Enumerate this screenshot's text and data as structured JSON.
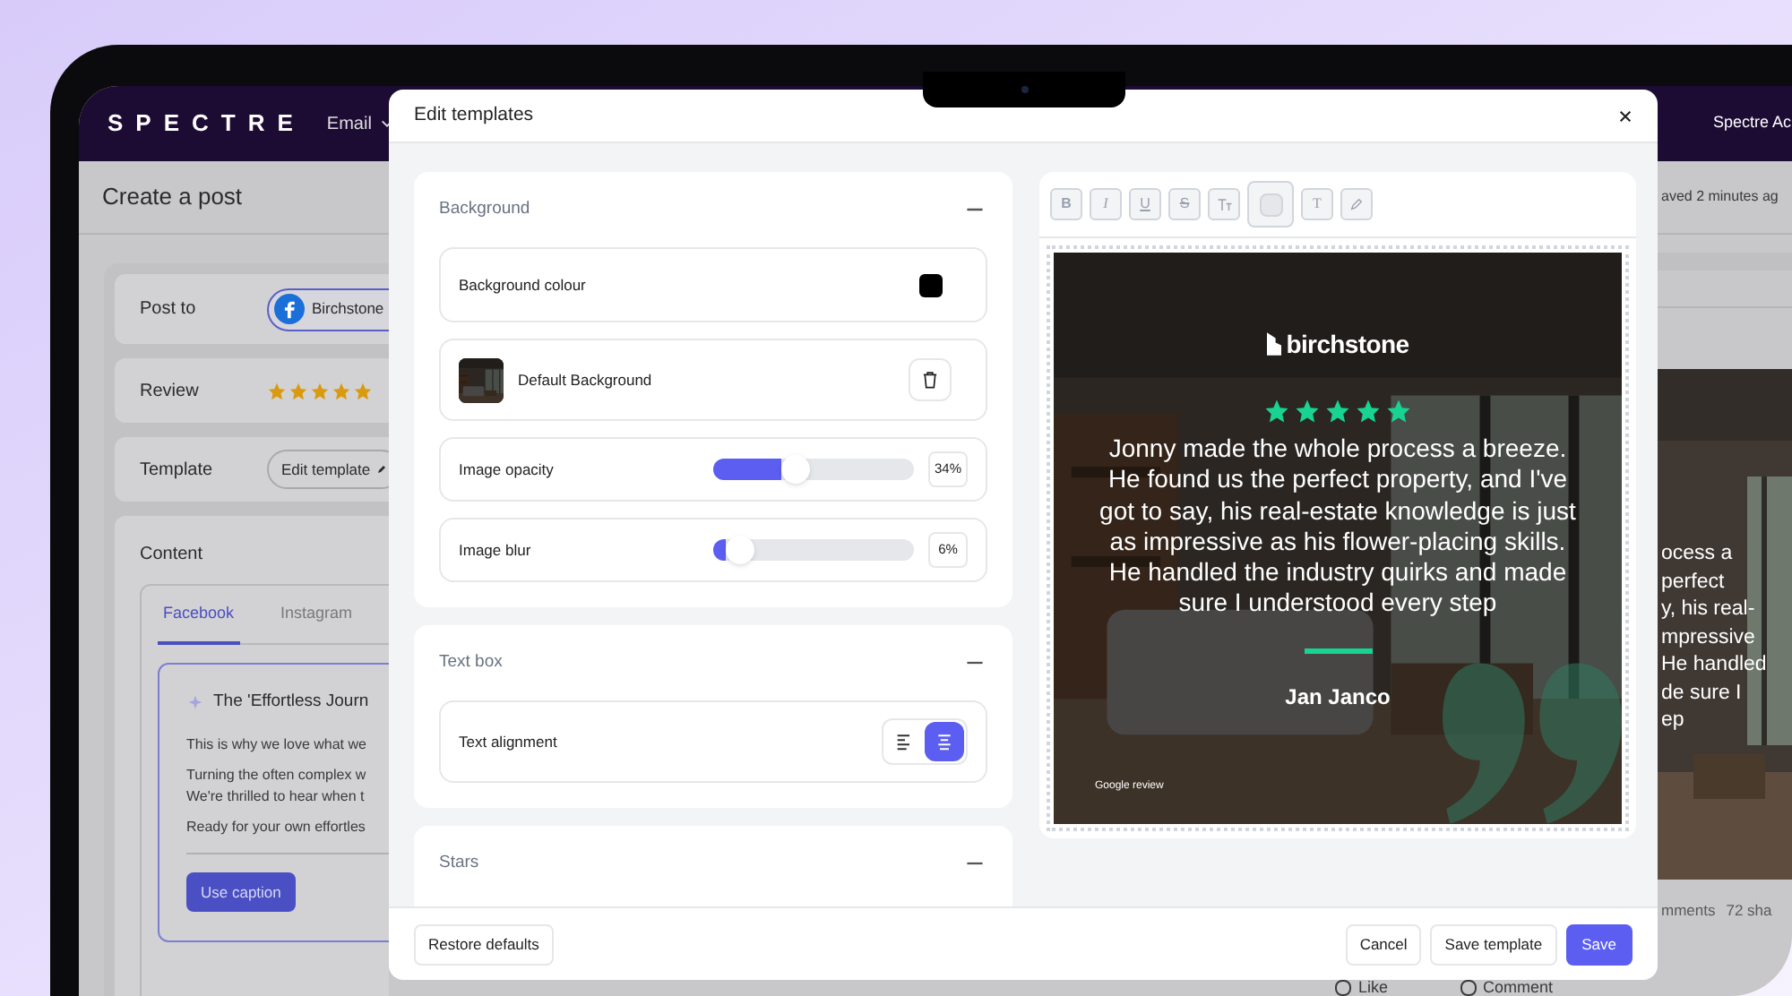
{
  "app": {
    "logo": "SPECTRE",
    "nav": [
      {
        "label": "Email"
      }
    ],
    "account": "Spectre Ac",
    "page_title": "Create a post",
    "save_status": "aved 2 minutes ag",
    "post_to": {
      "label": "Post to",
      "account": "Birchstone"
    },
    "review": {
      "label": "Review",
      "stars": 5
    },
    "template": {
      "label": "Template",
      "button": "Edit template"
    },
    "content": {
      "label": "Content",
      "tabs": [
        {
          "label": "Facebook",
          "selected": true
        },
        {
          "label": "Instagram",
          "selected": false
        }
      ],
      "caption": {
        "title": "The 'Effortless Journ",
        "paragraphs": [
          [
            "This is why we love what we"
          ],
          [
            "Turning the often complex w",
            "We're thrilled to hear when t"
          ],
          [
            "Ready for your own effortles"
          ]
        ],
        "button": "Use caption"
      }
    },
    "post_preview": {
      "quote_lines": [
        "ocess a",
        "perfect",
        "y, his real-",
        "mpressive",
        "He handled",
        "de sure I",
        "ep"
      ],
      "stats": [
        "mments",
        "72 sha"
      ],
      "actions": [
        "Like",
        "Comment"
      ]
    }
  },
  "modal": {
    "title": "Edit templates",
    "sections": [
      {
        "title": "Background",
        "expanded": true,
        "rows": [
          {
            "kind": "color",
            "label": "Background colour",
            "color": "#000000"
          },
          {
            "label": "Default Background"
          },
          {
            "kind": "slider",
            "label": "Image opacity",
            "level": 0.34,
            "reading": "34%"
          },
          {
            "kind": "slider",
            "label": "Image blur",
            "level": 0.06,
            "reading": "6%"
          }
        ]
      },
      {
        "title": "Text box",
        "expanded": true,
        "rows": [
          {
            "kind": "alignment",
            "label": "Text alignment",
            "options": [
              {
                "kind": "left",
                "selected": false
              },
              {
                "kind": "center",
                "selected": true
              }
            ]
          }
        ]
      },
      {
        "title": "Stars",
        "expanded": true
      }
    ],
    "toolbar": [
      {
        "kind": "bold",
        "label": "B",
        "disabled": true
      },
      {
        "kind": "italic",
        "label": "I",
        "disabled": true
      },
      {
        "kind": "underline",
        "label": "U",
        "disabled": true
      },
      {
        "kind": "strike",
        "label": "S",
        "disabled": true
      },
      {
        "kind": "size",
        "disabled": true
      },
      {
        "kind": "color",
        "disabled": true
      },
      {
        "kind": "text",
        "label": "T",
        "disabled": true
      },
      {
        "kind": "pen",
        "disabled": true
      }
    ],
    "preview": {
      "brand": "birchstone",
      "stars": 5,
      "quote": "Jonny made the whole process a breeze. He found us the perfect property, and I've got to say, his real-estate knowledge is just as impressive as his flower-placing skills. He handled the industry quirks and made sure I understood every step",
      "author": "Jan Janco",
      "source": "Google review"
    },
    "footer": {
      "restore": "Restore defaults",
      "cancel": "Cancel",
      "save_template": "Save template",
      "save": "Save"
    }
  }
}
